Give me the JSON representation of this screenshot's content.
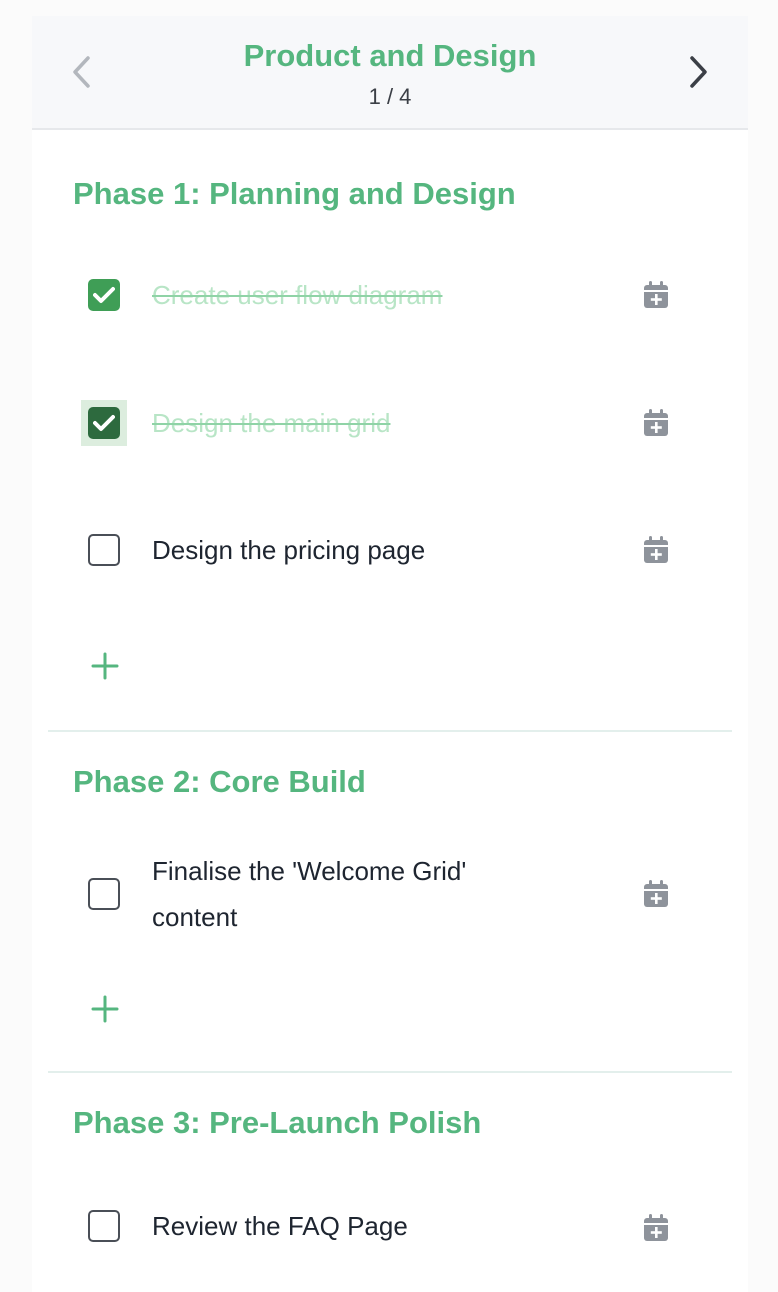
{
  "header": {
    "title": "Product and Design",
    "page_indicator": "1 / 4"
  },
  "sections": [
    {
      "title": "Phase 1: Planning and Design",
      "tasks": [
        {
          "label": "Create user flow diagram",
          "done": true
        },
        {
          "label": "Design the main grid",
          "done": true
        },
        {
          "label": "Design the pricing page",
          "done": false
        }
      ]
    },
    {
      "title": "Phase 2: Core Build",
      "tasks": [
        {
          "label": "Finalise the 'Welcome Grid' content",
          "done": false
        }
      ]
    },
    {
      "title": "Phase 3: Pre-Launch Polish",
      "tasks": [
        {
          "label": "Review the FAQ Page",
          "done": false
        }
      ]
    }
  ],
  "icons": {
    "prev": "chevron-left-icon",
    "next": "chevron-right-icon",
    "calendar": "calendar-plus-icon",
    "add": "plus-icon",
    "check": "check-icon"
  },
  "colors": {
    "accent": "#55b67f",
    "checked": "#3f9e56",
    "checked_focus": "#2d6a3e",
    "done_text": "#b8e5c6",
    "icon_gray": "#8e939b"
  }
}
